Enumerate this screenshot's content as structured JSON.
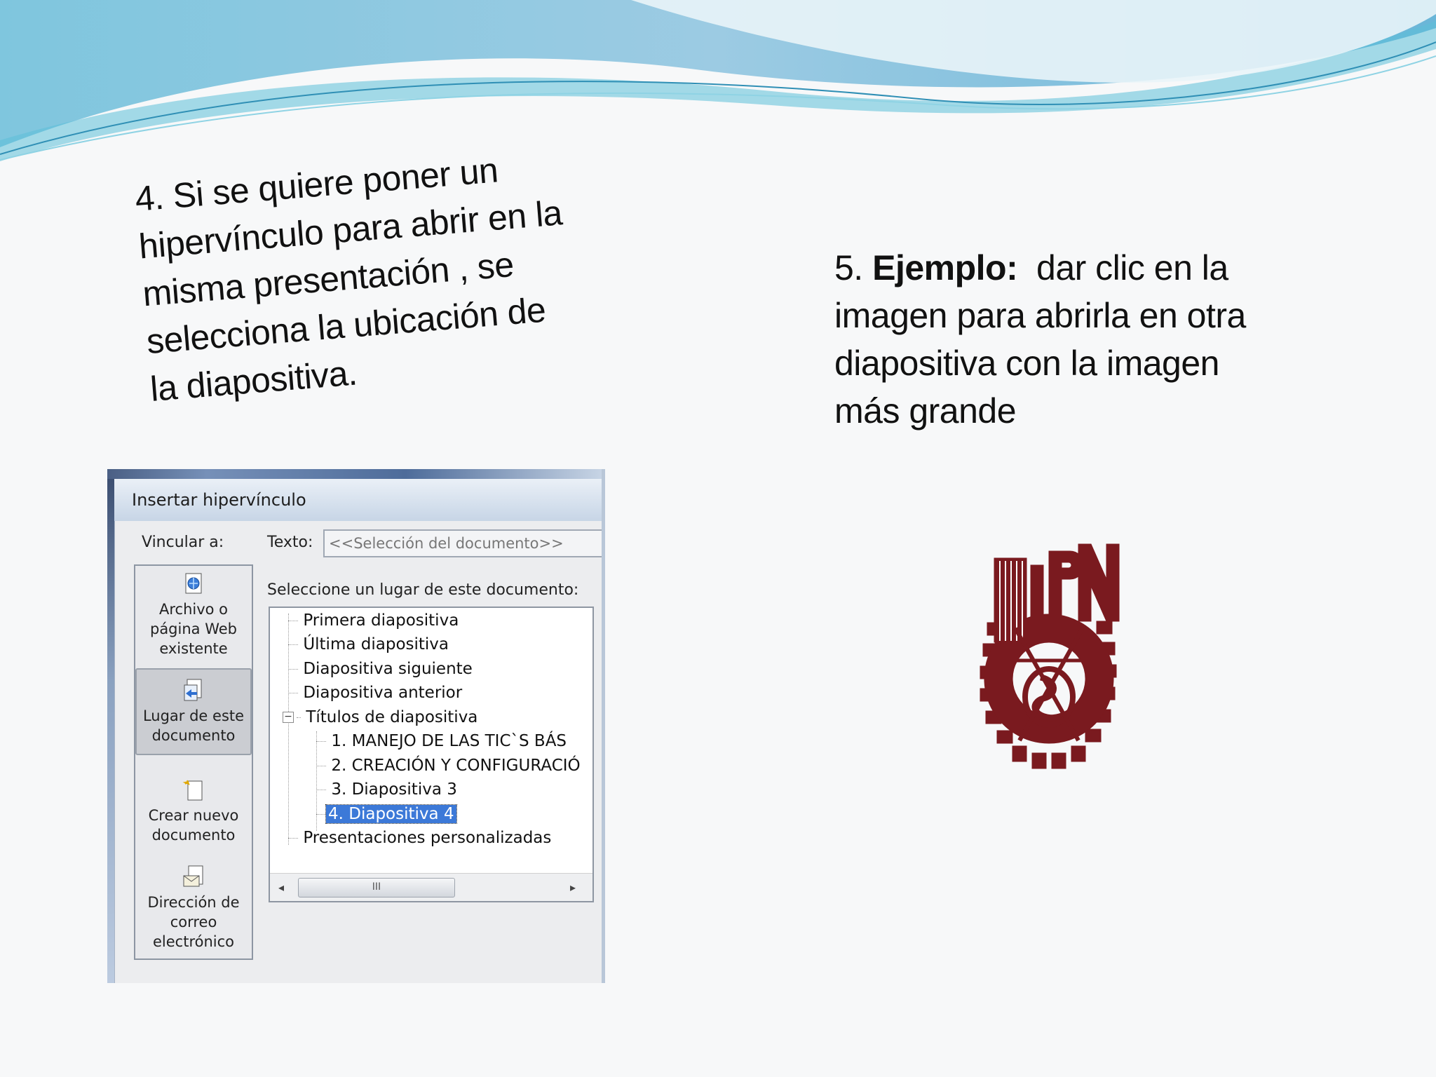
{
  "slide": {
    "left_text_lines": [
      "4. Si se quiere poner un",
      "hipervínculo para abrir en la",
      "misma presentación , se",
      "selecciona la ubicación de",
      "la diapositiva."
    ],
    "right_text": {
      "prefix": "5. ",
      "bold": "Ejemplo:",
      "line1_rest": "  dar clic en la",
      "lines": [
        "imagen para abrirla en otra",
        "diapositiva con la imagen",
        "más grande"
      ]
    }
  },
  "dialog": {
    "title": "Insertar hipervínculo",
    "vincular_label": "Vincular a:",
    "texto_label": "Texto:",
    "texto_value": "<<Selección del documento>>",
    "select_label": "Seleccione un lugar de este documento:",
    "link_options": [
      {
        "lines": [
          "Archivo o",
          "página Web",
          "existente"
        ],
        "icon": "web-file-icon"
      },
      {
        "lines": [
          "Lugar de este",
          "documento"
        ],
        "icon": "place-in-document-icon",
        "active": true
      },
      {
        "lines": [
          "Crear nuevo",
          "documento"
        ],
        "icon": "new-document-icon"
      },
      {
        "lines": [
          "Dirección de",
          "correo",
          "electrónico"
        ],
        "icon": "email-address-icon"
      }
    ],
    "tree": [
      "Primera diapositiva",
      "Última diapositiva",
      "Diapositiva siguiente",
      "Diapositiva anterior",
      "Títulos de diapositiva",
      "1. MANEJO DE LAS TIC`S BÁS",
      "2. CREACIÓN Y CONFIGURACIÓ",
      "3. Diapositiva 3",
      "4. Diapositiva 4",
      "Presentaciones personalizadas"
    ],
    "expander_symbol": "−",
    "scroll_thumb_grip": "III",
    "selected_index": 8
  },
  "logo": {
    "text": "IPN",
    "color": "#7a1a1f"
  }
}
